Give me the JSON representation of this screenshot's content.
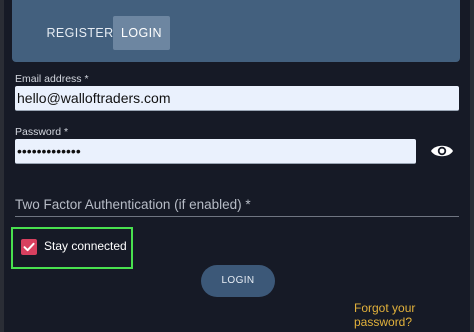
{
  "tabs": {
    "register": "REGISTER",
    "login": "LOGIN"
  },
  "form": {
    "email_label": "Email address *",
    "email_value": "hello@walloftraders.com",
    "password_label": "Password *",
    "password_value": "•••••••••••••",
    "tfa_placeholder": "Two Factor Authentication (if enabled) *",
    "stay_connected_label": "Stay connected",
    "stay_connected_checked": true,
    "login_button": "LOGIN",
    "forgot_password": "Forgot your password?"
  },
  "colors": {
    "background": "#161a26",
    "tab_bar": "#43607e",
    "checkbox": "#d8405f",
    "highlight_outline": "#49e14f",
    "link": "#e2b13b"
  },
  "icons": {
    "password_toggle": "eye-icon"
  }
}
